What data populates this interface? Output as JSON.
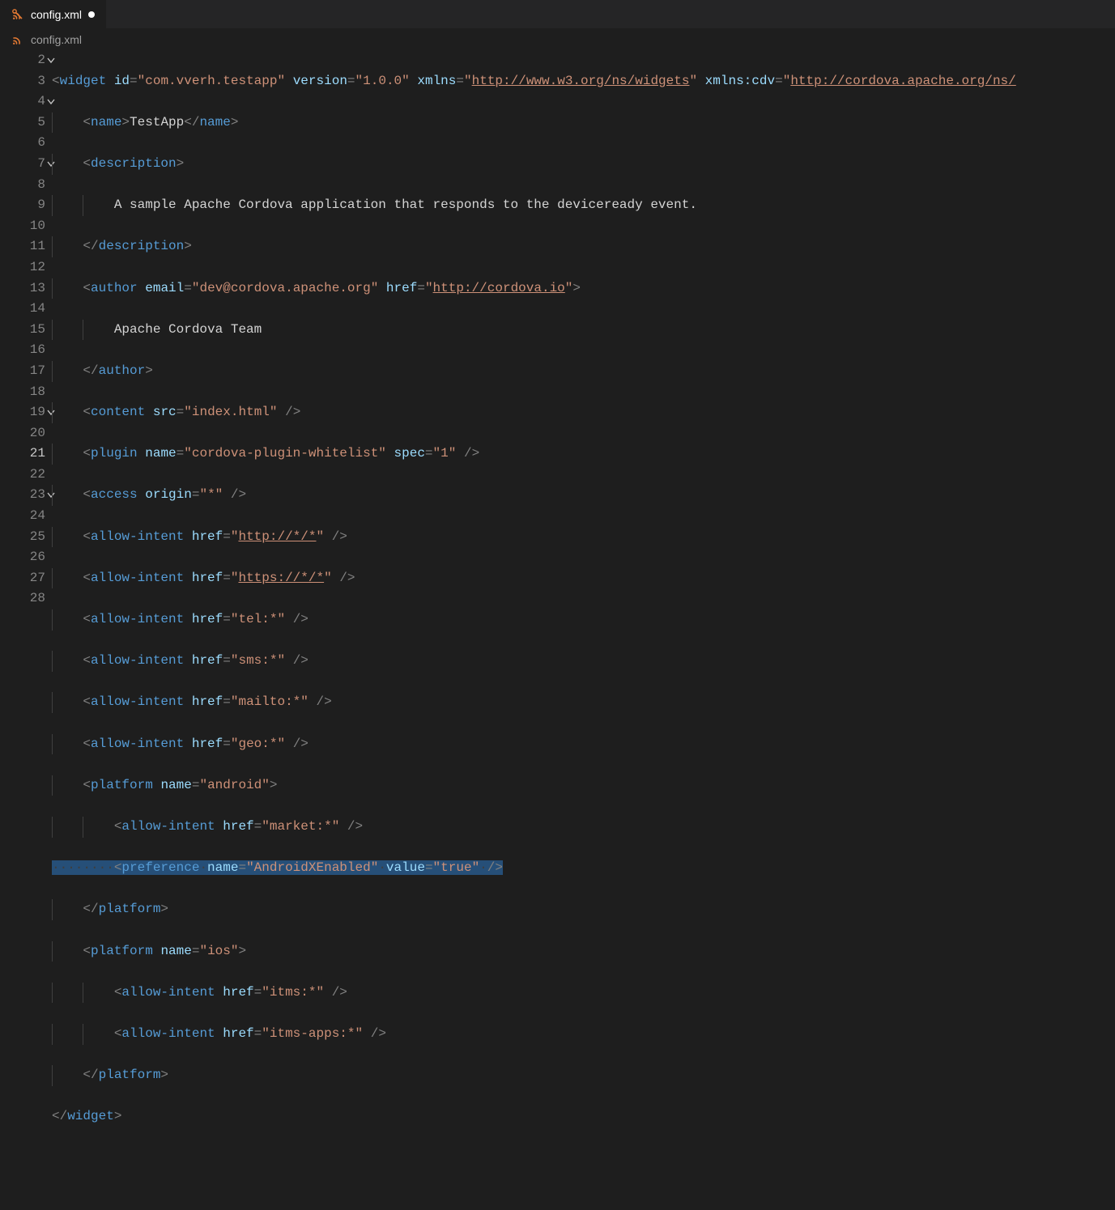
{
  "tab": {
    "filename": "config.xml",
    "dirty": true
  },
  "breadcrumb": {
    "filename": "config.xml"
  },
  "gutter": {
    "start": 2,
    "end": 28,
    "folds": [
      2,
      4,
      7,
      19,
      23
    ],
    "active": 21
  },
  "code": {
    "widget": {
      "id": "com.vverh.testapp",
      "version": "1.0.0",
      "xmlns": "http://www.w3.org/ns/widgets",
      "xmlns_cdv": "http://cordova.apache.org/ns/"
    },
    "name": "TestApp",
    "description": "A sample Apache Cordova application that responds to the deviceready event.",
    "author": {
      "email": "dev@cordova.apache.org",
      "href": "http://cordova.io",
      "text": "Apache Cordova Team"
    },
    "content_src": "index.html",
    "plugin": {
      "name": "cordova-plugin-whitelist",
      "spec": "1"
    },
    "access_origin": "*",
    "allow_intent": {
      "http": "http://*/*",
      "https": "https://*/*",
      "tel": "tel:*",
      "sms": "sms:*",
      "mailto": "mailto:*",
      "geo": "geo:*",
      "market": "market:*",
      "itms": "itms:*",
      "itms_apps": "itms-apps:*"
    },
    "platform_android": "android",
    "preference": {
      "name": "AndroidXEnabled",
      "value": "true"
    },
    "platform_ios": "ios"
  }
}
